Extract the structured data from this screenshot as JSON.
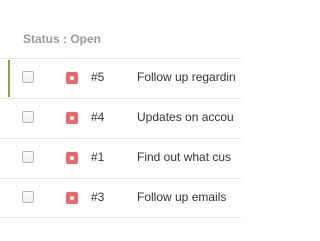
{
  "group": {
    "header": "Status : Open"
  },
  "tickets": [
    {
      "id": "#5",
      "subject": "Follow up regardin",
      "selected": true
    },
    {
      "id": "#4",
      "subject": "Updates on accou",
      "selected": false
    },
    {
      "id": "#1",
      "subject": "Find out what cus",
      "selected": false
    },
    {
      "id": "#3",
      "subject": "Follow up emails",
      "selected": false
    }
  ],
  "colors": {
    "selected_accent": "#8aa53a",
    "priority_badge": "#e86a6a",
    "header_text": "#9a9a9a",
    "row_text": "#333333"
  },
  "icons": {
    "priority": "priority-high-icon"
  }
}
